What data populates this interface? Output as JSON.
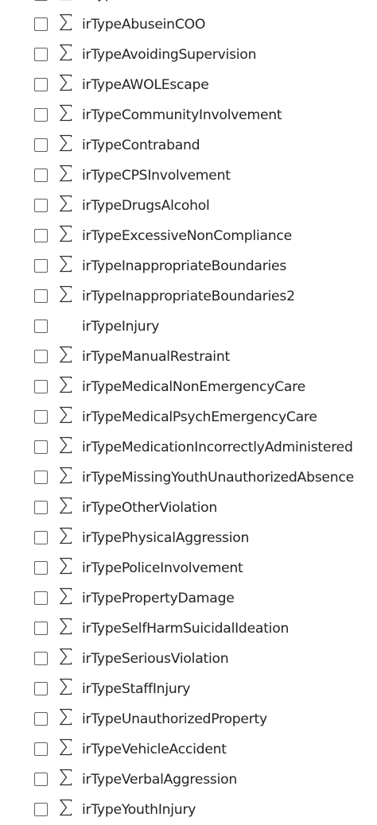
{
  "fields": [
    {
      "name": "irTypeAbuseinCOO",
      "aggregate": true
    },
    {
      "name": "irTypeAbuseinCOO",
      "aggregate": true
    },
    {
      "name": "irTypeAvoidingSupervision",
      "aggregate": true
    },
    {
      "name": "irTypeAWOLEscape",
      "aggregate": true
    },
    {
      "name": "irTypeCommunityInvolvement",
      "aggregate": true
    },
    {
      "name": "irTypeContraband",
      "aggregate": true
    },
    {
      "name": "irTypeCPSInvolvement",
      "aggregate": true
    },
    {
      "name": "irTypeDrugsAlcohol",
      "aggregate": true
    },
    {
      "name": "irTypeExcessiveNonCompliance",
      "aggregate": true
    },
    {
      "name": "irTypeInappropriateBoundaries",
      "aggregate": true
    },
    {
      "name": "irTypeInappropriateBoundaries2",
      "aggregate": true
    },
    {
      "name": "irTypeInjury",
      "aggregate": false
    },
    {
      "name": "irTypeManualRestraint",
      "aggregate": true
    },
    {
      "name": "irTypeMedicalNonEmergencyCare",
      "aggregate": true
    },
    {
      "name": "irTypeMedicalPsychEmergencyCare",
      "aggregate": true
    },
    {
      "name": "irTypeMedicationIncorrectlyAdministered",
      "aggregate": true
    },
    {
      "name": "irTypeMissingYouthUnauthorizedAbsence",
      "aggregate": true
    },
    {
      "name": "irTypeOtherViolation",
      "aggregate": true
    },
    {
      "name": "irTypePhysicalAggression",
      "aggregate": true
    },
    {
      "name": "irTypePoliceInvolvement",
      "aggregate": true
    },
    {
      "name": "irTypePropertyDamage",
      "aggregate": true
    },
    {
      "name": "irTypeSelfHarmSuicidalIdeation",
      "aggregate": true
    },
    {
      "name": "irTypeSeriousViolation",
      "aggregate": true
    },
    {
      "name": "irTypeStaffInjury",
      "aggregate": true
    },
    {
      "name": "irTypeUnauthorizedProperty",
      "aggregate": true
    },
    {
      "name": "irTypeVehicleAccident",
      "aggregate": true
    },
    {
      "name": "irTypeVerbalAggression",
      "aggregate": true
    },
    {
      "name": "irTypeYouthInjury",
      "aggregate": true
    }
  ],
  "aggregate_icon": "sigma-icon",
  "colors": {
    "text": "#252423",
    "checkbox_border": "#605e5c",
    "icon": "#323130",
    "background": "#ffffff"
  }
}
